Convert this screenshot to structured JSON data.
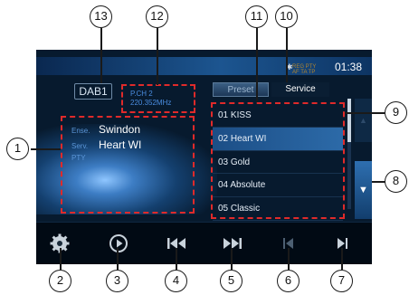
{
  "tuner": {
    "band": "DAB1",
    "pch_line1": "P.CH 2",
    "pch_line2": "220.352MHz",
    "ensemble_label": "Ense.",
    "ensemble_value": "Swindon",
    "service_label": "Serv.",
    "service_value": "Heart WI",
    "pty_label": "PTY"
  },
  "tabs": {
    "preset": "Preset",
    "service": "Service"
  },
  "status": {
    "line1": "REG PTY",
    "line2": "AF TA TP",
    "clock": "01:38"
  },
  "service_list": [
    {
      "number": "01",
      "name": "KISS"
    },
    {
      "number": "02",
      "name": "Heart WI"
    },
    {
      "number": "03",
      "name": "Gold"
    },
    {
      "number": "04",
      "name": "Absolute"
    },
    {
      "number": "05",
      "name": "Classic"
    }
  ],
  "list_items": [
    "01 KISS",
    "02 Heart WI",
    "03 Gold",
    "04 Absolute",
    "05 Classic"
  ],
  "selected_index": 1,
  "icons": {
    "settings": "settings-gear-icon",
    "play": "play-circle-icon",
    "seek_back": "seek-back-icon",
    "seek_forward": "seek-forward-icon",
    "prev": "prev-track-icon",
    "next": "next-track-icon",
    "down": "scroll-down-icon",
    "up": "scroll-up-icon",
    "bluetooth": "bluetooth-icon"
  },
  "glyphs": {
    "down": "▼",
    "up": "▲",
    "bluetooth": "✱"
  },
  "callouts": [
    "1",
    "2",
    "3",
    "4",
    "5",
    "6",
    "7",
    "8",
    "9",
    "10",
    "11",
    "12",
    "13"
  ],
  "colors": {
    "accent_red": "#e02a2a",
    "highlight_blue": "#2c6aa8",
    "screen_bg": "#071a2e"
  }
}
